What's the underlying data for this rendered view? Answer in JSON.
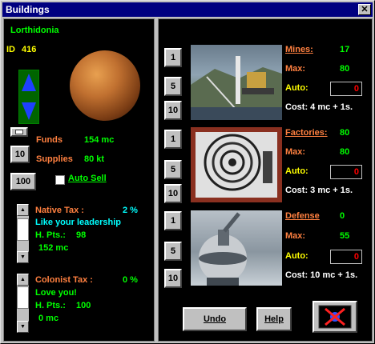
{
  "window": {
    "title": "Buildings",
    "close_glyph": "✕"
  },
  "planet": {
    "name": "Lorthidonia",
    "id_label": "ID",
    "id_value": "416"
  },
  "resources": {
    "funds_label": "Funds",
    "funds_value": "154 mc",
    "supplies_label": "Supplies",
    "supplies_value": "80 kt",
    "btn_1": "1",
    "btn_10": "10",
    "btn_100": "100",
    "auto_sell": "Auto Sell"
  },
  "native": {
    "tax_label": "Native Tax :",
    "tax_value": "2 %",
    "mood": "Like your leadership",
    "hpts_label": "H. Pts.:",
    "hpts_value": "98",
    "income": "152 mc"
  },
  "colonist": {
    "tax_label": "Colonist Tax :",
    "tax_value": "0 %",
    "mood": "Love you!",
    "hpts_label": "H. Pts.:",
    "hpts_value": "100",
    "income": "0 mc"
  },
  "buildings": [
    {
      "name": "Mines:",
      "current": "17",
      "max_label": "Max:",
      "max": "80",
      "auto_label": "Auto:",
      "auto": "0",
      "cost": "Cost: 4 mc + 1s."
    },
    {
      "name": "Factories:",
      "current": "80",
      "max_label": "Max:",
      "max": "80",
      "auto_label": "Auto:",
      "auto": "0",
      "cost": "Cost: 3 mc + 1s."
    },
    {
      "name": "Defense",
      "current": "0",
      "max_label": "Max:",
      "max": "55",
      "auto_label": "Auto:",
      "auto": "0",
      "cost": "Cost: 10 mc + 1s."
    }
  ],
  "increment_buttons": [
    "1",
    "5",
    "10"
  ],
  "actions": {
    "undo": "Undo",
    "help": "Help"
  },
  "colors": {
    "panel": "#000000",
    "label_orange": "#ff8040",
    "value_green": "#00ff00",
    "auto_red": "#ff0000"
  }
}
